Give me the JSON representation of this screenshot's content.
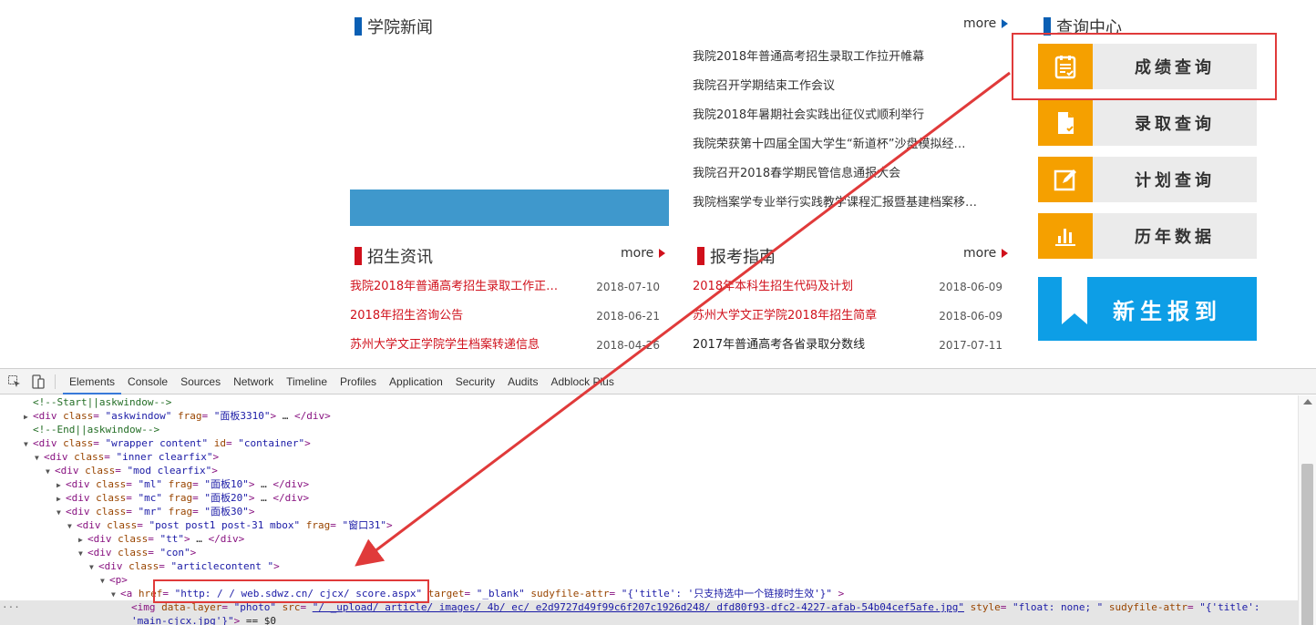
{
  "news": {
    "title": "学院新闻",
    "more": "more",
    "items": [
      "我院2018年普通高考招生录取工作拉开帷幕",
      "我院召开学期结束工作会议",
      "我院2018年暑期社会实践出征仪式顺利举行",
      "我院荣获第十四届全国大学生“新道杯”沙盘模拟经…",
      "我院召开2018春学期民管信息通报大会",
      "我院档案学专业举行实践教学课程汇报暨基建档案移…"
    ]
  },
  "query_center": {
    "title": "查询中心",
    "buttons": [
      {
        "label": "成绩查询",
        "icon": "score-doc-icon"
      },
      {
        "label": "录取查询",
        "icon": "admission-doc-icon"
      },
      {
        "label": "计划查询",
        "icon": "plan-edit-icon"
      },
      {
        "label": "历年数据",
        "icon": "bar-chart-icon"
      }
    ],
    "register": {
      "label": "新生报到",
      "icon": "bookmark-icon"
    }
  },
  "admissions": {
    "title": "招生资讯",
    "more": "more",
    "items": [
      {
        "title": "我院2018年普通高考招生录取工作正…",
        "date": "2018-07-10"
      },
      {
        "title": "2018年招生咨询公告",
        "date": "2018-06-21"
      },
      {
        "title": "苏州大学文正学院学生档案转递信息",
        "date": "2018-04-26"
      }
    ]
  },
  "guide": {
    "title": "报考指南",
    "more": "more",
    "items": [
      {
        "title": "2018年本科生招生代码及计划",
        "date": "2018-06-09",
        "dark": false
      },
      {
        "title": "苏州大学文正学院2018年招生简章",
        "date": "2018-06-09",
        "dark": false
      },
      {
        "title": "2017年普通高考各省录取分数线",
        "date": "2017-07-11",
        "dark": true
      }
    ]
  },
  "devtools": {
    "tabs": [
      "Elements",
      "Console",
      "Sources",
      "Network",
      "Timeline",
      "Profiles",
      "Application",
      "Security",
      "Audits",
      "Adblock Plus"
    ],
    "active_tab": "Elements",
    "lines": [
      {
        "indent": 0,
        "arrow": "",
        "parts": [
          [
            "cmt",
            "<!--Start||askwindow-->"
          ]
        ]
      },
      {
        "indent": 0,
        "arrow": "▶",
        "parts": [
          [
            "tag",
            "<div "
          ],
          [
            "attr",
            "class"
          ],
          [
            "tag",
            "= "
          ],
          [
            "val",
            "\"askwindow\""
          ],
          [
            "attr",
            " frag"
          ],
          [
            "tag",
            "= "
          ],
          [
            "val",
            "\"面板3310\""
          ],
          [
            "tag",
            ">"
          ],
          [
            "txt",
            " … "
          ],
          [
            "tag",
            "</div>"
          ]
        ]
      },
      {
        "indent": 0,
        "arrow": "",
        "parts": [
          [
            "cmt",
            "<!--End||askwindow-->"
          ]
        ]
      },
      {
        "indent": 0,
        "arrow": "▼",
        "parts": [
          [
            "tag",
            "<div "
          ],
          [
            "attr",
            "class"
          ],
          [
            "tag",
            "= "
          ],
          [
            "val",
            "\"wrapper content\""
          ],
          [
            "attr",
            " id"
          ],
          [
            "tag",
            "= "
          ],
          [
            "val",
            "\"container\""
          ],
          [
            "tag",
            ">"
          ]
        ]
      },
      {
        "indent": 1,
        "arrow": "▼",
        "parts": [
          [
            "tag",
            "<div "
          ],
          [
            "attr",
            "class"
          ],
          [
            "tag",
            "= "
          ],
          [
            "val",
            "\"inner clearfix\""
          ],
          [
            "tag",
            ">"
          ]
        ]
      },
      {
        "indent": 2,
        "arrow": "▼",
        "parts": [
          [
            "tag",
            "<div "
          ],
          [
            "attr",
            "class"
          ],
          [
            "tag",
            "= "
          ],
          [
            "val",
            "\"mod clearfix\""
          ],
          [
            "tag",
            ">"
          ]
        ]
      },
      {
        "indent": 3,
        "arrow": "▶",
        "parts": [
          [
            "tag",
            "<div "
          ],
          [
            "attr",
            "class"
          ],
          [
            "tag",
            "= "
          ],
          [
            "val",
            "\"ml\""
          ],
          [
            "attr",
            " frag"
          ],
          [
            "tag",
            "= "
          ],
          [
            "val",
            "\"面板10\""
          ],
          [
            "tag",
            ">"
          ],
          [
            "txt",
            " … "
          ],
          [
            "tag",
            "</div>"
          ]
        ]
      },
      {
        "indent": 3,
        "arrow": "▶",
        "parts": [
          [
            "tag",
            "<div "
          ],
          [
            "attr",
            "class"
          ],
          [
            "tag",
            "= "
          ],
          [
            "val",
            "\"mc\""
          ],
          [
            "attr",
            " frag"
          ],
          [
            "tag",
            "= "
          ],
          [
            "val",
            "\"面板20\""
          ],
          [
            "tag",
            ">"
          ],
          [
            "txt",
            " … "
          ],
          [
            "tag",
            "</div>"
          ]
        ]
      },
      {
        "indent": 3,
        "arrow": "▼",
        "parts": [
          [
            "tag",
            "<div "
          ],
          [
            "attr",
            "class"
          ],
          [
            "tag",
            "= "
          ],
          [
            "val",
            "\"mr\""
          ],
          [
            "attr",
            " frag"
          ],
          [
            "tag",
            "= "
          ],
          [
            "val",
            "\"面板30\""
          ],
          [
            "tag",
            ">"
          ]
        ]
      },
      {
        "indent": 4,
        "arrow": "▼",
        "parts": [
          [
            "tag",
            "<div "
          ],
          [
            "attr",
            "class"
          ],
          [
            "tag",
            "= "
          ],
          [
            "val",
            "\"post post1 post-31 mbox\""
          ],
          [
            "attr",
            " frag"
          ],
          [
            "tag",
            "= "
          ],
          [
            "val",
            "\"窗口31\""
          ],
          [
            "tag",
            ">"
          ]
        ]
      },
      {
        "indent": 5,
        "arrow": "▶",
        "parts": [
          [
            "tag",
            "<div "
          ],
          [
            "attr",
            "class"
          ],
          [
            "tag",
            "= "
          ],
          [
            "val",
            "\"tt\""
          ],
          [
            "tag",
            ">"
          ],
          [
            "txt",
            " … "
          ],
          [
            "tag",
            "</div>"
          ]
        ]
      },
      {
        "indent": 5,
        "arrow": "▼",
        "parts": [
          [
            "tag",
            "<div "
          ],
          [
            "attr",
            "class"
          ],
          [
            "tag",
            "= "
          ],
          [
            "val",
            "\"con\""
          ],
          [
            "tag",
            ">"
          ]
        ]
      },
      {
        "indent": 6,
        "arrow": "▼",
        "parts": [
          [
            "tag",
            "<div "
          ],
          [
            "attr",
            "class"
          ],
          [
            "tag",
            "= "
          ],
          [
            "val",
            "\"articlecontent \""
          ],
          [
            "tag",
            ">"
          ]
        ]
      },
      {
        "indent": 7,
        "arrow": "▼",
        "parts": [
          [
            "tag",
            "<p>"
          ]
        ]
      },
      {
        "indent": 8,
        "arrow": "▼",
        "parts": [
          [
            "tag",
            "<a "
          ],
          [
            "attr",
            "href"
          ],
          [
            "tag",
            "= "
          ],
          [
            "val",
            "\"http: / / web.sdwz.cn/ cjcx/ score.aspx\""
          ],
          [
            "attr",
            " target"
          ],
          [
            "tag",
            "= "
          ],
          [
            "val",
            "\"_blank\""
          ],
          [
            "attr",
            " sudyfile-attr"
          ],
          [
            "tag",
            "= "
          ],
          [
            "val",
            "\"{'title': '只支持选中一个链接时生效'}\""
          ],
          [
            "tag",
            " >"
          ]
        ]
      },
      {
        "indent": 9,
        "arrow": "",
        "selected": true,
        "parts": [
          [
            "tag",
            "<img "
          ],
          [
            "attr",
            "data-layer"
          ],
          [
            "tag",
            "= "
          ],
          [
            "val",
            "\"photo\""
          ],
          [
            "attr",
            " src"
          ],
          [
            "tag",
            "= "
          ],
          [
            "link",
            "\"/ _upload/ article/ images/ 4b/ ec/ e2d9727d49f99c6f207c1926d248/ dfd80f93-dfc2-4227-afab-54b04cef5afe.jpg\""
          ],
          [
            "attr",
            " style"
          ],
          [
            "tag",
            "= "
          ],
          [
            "val",
            "\"float: none; \""
          ],
          [
            "attr",
            " sudyfile-attr"
          ],
          [
            "tag",
            "= "
          ],
          [
            "val",
            "\"{'title':"
          ]
        ]
      },
      {
        "indent": 9,
        "arrow": "",
        "selected": true,
        "parts": [
          [
            "val",
            "'main-cjcx.jpg'}\""
          ],
          [
            "tag",
            ">"
          ],
          [
            "txt",
            "  == $0"
          ]
        ]
      }
    ]
  }
}
